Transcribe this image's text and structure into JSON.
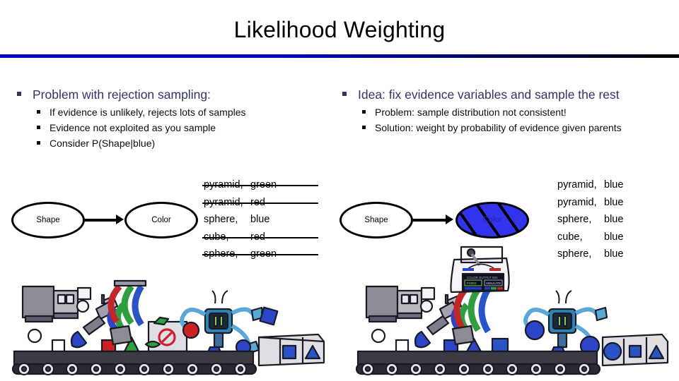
{
  "slide": {
    "title": "Likelihood Weighting",
    "rule_color_start": "#0000CC",
    "rule_color_end": "#000000"
  },
  "left_column": {
    "bullet": "Problem with rejection sampling:",
    "sub_bullets": [
      "If evidence is unlikely, rejects lots of samples",
      "Evidence not exploited as you sample",
      "Consider P(Shape|blue)"
    ]
  },
  "right_column": {
    "bullet": "Idea: fix evidence variables and sample the rest",
    "sub_bullets": [
      "Problem: sample distribution not consistent!",
      "Solution: weight by probability of evidence given parents"
    ]
  },
  "net_left": {
    "parent_node": "Shape",
    "child_node": "Color",
    "child_observed": false
  },
  "net_right": {
    "parent_node": "Shape",
    "child_node": "Color",
    "child_observed": true,
    "child_fill_color": "#3333EE"
  },
  "samples_left": [
    {
      "shape": "pyramid,",
      "color": "green",
      "rejected": true
    },
    {
      "shape": "pyramid,",
      "color": "red",
      "rejected": true
    },
    {
      "shape": "sphere,",
      "color": "blue",
      "rejected": false
    },
    {
      "shape": "cube,",
      "color": "red",
      "rejected": true
    },
    {
      "shape": "sphere,",
      "color": "green",
      "rejected": true
    }
  ],
  "samples_right": [
    {
      "shape": "pyramid,",
      "color": "blue",
      "rejected": false
    },
    {
      "shape": "pyramid,",
      "color": "blue",
      "rejected": false
    },
    {
      "shape": "sphere,",
      "color": "blue",
      "rejected": false
    },
    {
      "shape": "cube,",
      "color": "blue",
      "rejected": false
    },
    {
      "shape": "sphere,",
      "color": "blue",
      "rejected": false
    }
  ],
  "scene_left": {
    "caption": "factory conveyor with paint robot and inspector robot rejecting items",
    "object_colors": [
      "#3344cc",
      "#cc2222",
      "#2e9e3e",
      "#ffffff"
    ],
    "reject_symbol": "no-entry"
  },
  "scene_right": {
    "caption": "factory conveyor with all blue objects and control console overlay",
    "object_colors": [
      "#2244cc"
    ],
    "console": {
      "header_text": "COLOR OUTPUT MIX",
      "left_button": "FIXED",
      "right_button": "SIMULATE"
    }
  }
}
